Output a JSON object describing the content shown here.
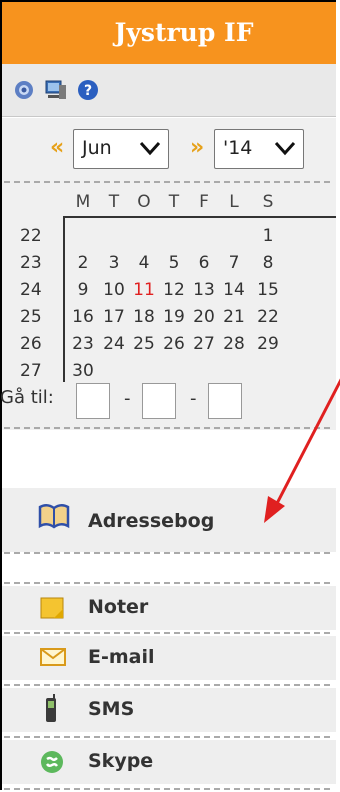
{
  "header": {
    "title": "Jystrup IF"
  },
  "toolbar": {
    "icons": [
      "settings-icon",
      "computer-icon",
      "help-icon"
    ]
  },
  "calendar": {
    "month": "Jun",
    "year": "'14",
    "prev": "«",
    "next": "»",
    "weekday_headers": [
      "M",
      "T",
      "O",
      "T",
      "F",
      "L",
      "S"
    ],
    "weeks": [
      {
        "week": "22",
        "days": [
          "",
          "",
          "",
          "",
          "",
          "",
          "1"
        ]
      },
      {
        "week": "23",
        "days": [
          "2",
          "3",
          "4",
          "5",
          "6",
          "7",
          "8"
        ]
      },
      {
        "week": "24",
        "days": [
          "9",
          "10",
          "11",
          "12",
          "13",
          "14",
          "15"
        ]
      },
      {
        "week": "25",
        "days": [
          "16",
          "17",
          "18",
          "19",
          "20",
          "21",
          "22"
        ]
      },
      {
        "week": "26",
        "days": [
          "23",
          "24",
          "25",
          "26",
          "27",
          "28",
          "29"
        ]
      },
      {
        "week": "27",
        "days": [
          "30",
          "",
          "",
          "",
          "",
          "",
          ""
        ]
      }
    ],
    "today": "11",
    "today_color": "#e02020",
    "goto_label": "Gå til:",
    "goto_sep": "-"
  },
  "menu": {
    "items": [
      {
        "label": "Adressebog",
        "icon": "book-icon"
      },
      {
        "label": "Noter",
        "icon": "note-icon"
      },
      {
        "label": "E-mail",
        "icon": "envelope-icon"
      },
      {
        "label": "SMS",
        "icon": "phone-icon"
      },
      {
        "label": "Skype",
        "icon": "skype-icon"
      }
    ]
  },
  "colors": {
    "accent": "#f7931e",
    "arrow": "#e02020"
  }
}
